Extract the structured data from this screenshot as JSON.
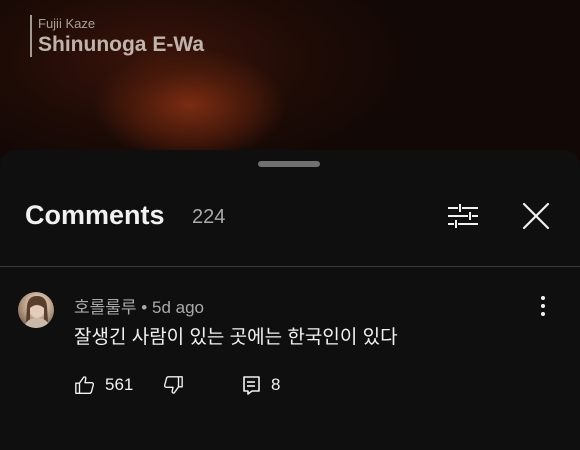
{
  "video": {
    "artist": "Fujii Kaze",
    "song_title": "Shinunoga E-Wa"
  },
  "comments_panel": {
    "title": "Comments",
    "count": "224",
    "icons": {
      "filter": "sliders-icon",
      "close": "close-icon"
    }
  },
  "comments": [
    {
      "author": "호롤룰루",
      "age": "5d ago",
      "text": "잘생긴 사람이 있는 곳에는 한국인이 있다",
      "likes": "561",
      "replies": "8",
      "icons": {
        "like": "thumbs-up-icon",
        "dislike": "thumbs-down-icon",
        "reply": "reply-icon",
        "more": "more-vertical-icon"
      }
    }
  ],
  "colors": {
    "background": "#0f0f0f",
    "primary_text": "#f1f1f1",
    "secondary_text": "#aaaaaa"
  }
}
